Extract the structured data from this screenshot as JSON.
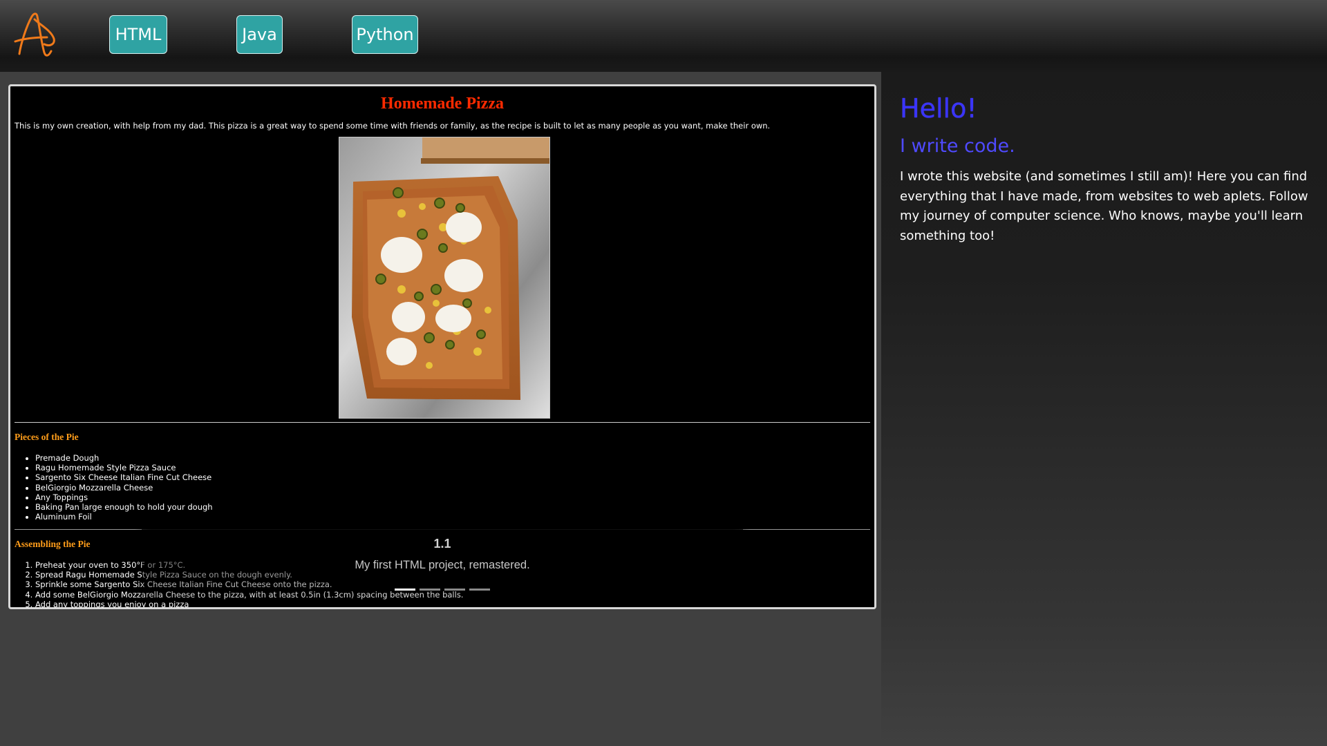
{
  "nav": {
    "logo_letter": "A",
    "items": [
      {
        "label": "HTML"
      },
      {
        "label": "Java"
      },
      {
        "label": "Python"
      }
    ]
  },
  "slide": {
    "title": "Homemade Pizza",
    "intro": "This is my own creation, with help from my dad. This pizza is a great way to spend some time with friends or family, as the recipe is built to let as many people as you want, make their own.",
    "ingredients_heading": "Pieces of the Pie",
    "ingredients": [
      "Premade Dough",
      "Ragu Homemade Style Pizza Sauce",
      "Sargento Six Cheese Italian Fine Cut Cheese",
      "BelGiorgio Mozzarella Cheese",
      "Any Toppings",
      "Baking Pan large enough to hold your dough",
      "Aluminum Foil"
    ],
    "steps_heading": "Assembling the Pie",
    "steps": [
      "Preheat your oven to 350°F or 175°C.",
      "Spread Ragu Homemade Style Pizza Sauce on the dough evenly.",
      "Sprinkle some Sargento Six Cheese Italian Fine Cut Cheese onto the pizza.",
      "Add some BelGiorgio Mozzarella Cheese to the pizza, with at least 0.5in (1.3cm) spacing between the balls.",
      "Add any toppings you enjoy on a pizza"
    ],
    "caption_number": "1.1",
    "caption_text": "My first HTML project, remastered.",
    "indicator_count": 4,
    "active_indicator": 1
  },
  "intro": {
    "greeting": "Hello!",
    "tagline": "I write code.",
    "bio": "I wrote this website (and sometimes I still am)! Here you can find everything that I have made, from websites to web aplets. Follow my journey of computer science. Who knows, maybe you'll learn something too!"
  },
  "colors": {
    "page_bg": "#404040",
    "nav_button": "#2fa3a3",
    "logo_orange": "#f07a1a",
    "slide_title": "#ff2a00",
    "section_heading": "#ff9d1a",
    "greeting_blue": "#3a34ff"
  },
  "icons": {
    "logo": "handwritten-a-logo-icon"
  }
}
